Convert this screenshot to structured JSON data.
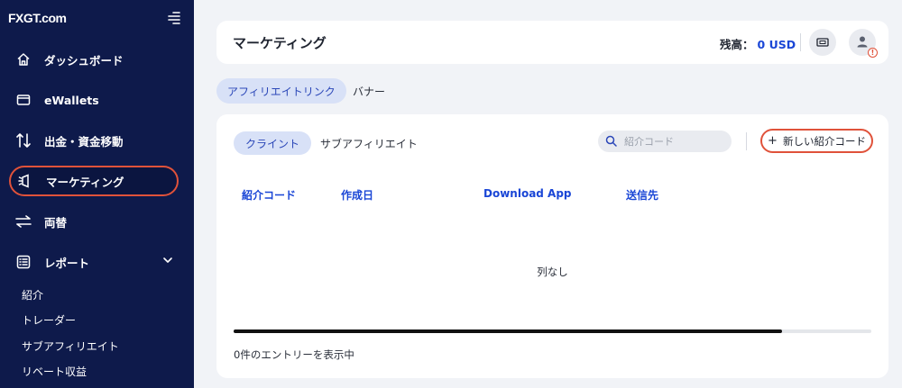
{
  "brand": {
    "logo_text": "FXGT.com"
  },
  "sidebar": {
    "items": [
      {
        "label": "ダッシュボード",
        "icon": "home-icon"
      },
      {
        "label": "eWallets",
        "icon": "wallet-icon"
      },
      {
        "label": "出金・資金移動",
        "icon": "transfer-icon"
      },
      {
        "label": "マーケティング",
        "icon": "marketing-icon"
      },
      {
        "label": "両替",
        "icon": "exchange-icon"
      },
      {
        "label": "レポート",
        "icon": "report-icon"
      }
    ],
    "report_sub_items": [
      "紹介",
      "トレーダー",
      "サブアフィリエイト",
      "リベート収益"
    ]
  },
  "header": {
    "title": "マーケティング",
    "balance_label": "残高：",
    "balance_value": "0 USD"
  },
  "top_tabs": [
    {
      "label": "アフィリエイトリンク",
      "active": true
    },
    {
      "label": "バナー",
      "active": false
    }
  ],
  "main": {
    "sub_tabs": [
      {
        "label": "クライント",
        "active": true
      },
      {
        "label": "サブアフィリエイト",
        "active": false
      }
    ],
    "search": {
      "placeholder": "紹介コード"
    },
    "new_code_button": "新しい紹介コード",
    "columns": [
      "紹介コード",
      "作成日",
      "Download App",
      "送信先"
    ],
    "empty_message": "列なし",
    "entries_info": "0件のエントリーを表示中",
    "scroll_progress": 0.86
  },
  "colors": {
    "sidebar_bg": "#0e1a4b",
    "accent_blue": "#1a46d6",
    "highlight_red": "#e0523a"
  }
}
